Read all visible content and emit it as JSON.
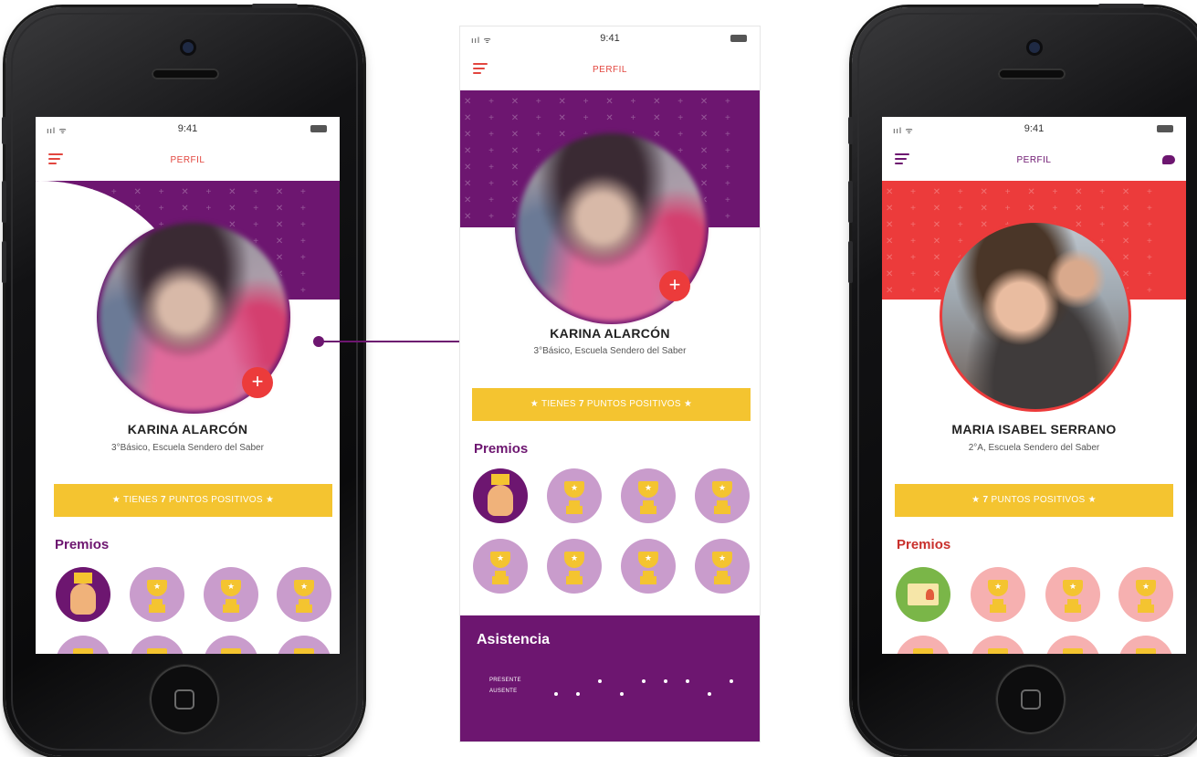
{
  "status": {
    "signal": "ııl ᯤ",
    "time": "9:41"
  },
  "left_phone": {
    "header_title": "PERFIL",
    "name": "KARINA ALARCÓN",
    "school": "3°Básico, Escuela Sendero del Saber",
    "points_prefix": "TIENES ",
    "points_value": "7",
    "points_suffix": " PUNTOS POSITIVOS",
    "awards_title": "Premios"
  },
  "center_screen": {
    "header_title": "PERFIL",
    "name": "KARINA ALARCÓN",
    "school": "3°Básico, Escuela Sendero del Saber",
    "points_prefix": "TIENES ",
    "points_value": "7",
    "points_suffix": " PUNTOS POSITIVOS",
    "awards_title": "Premios",
    "attendance_title": "Asistencia",
    "attendance_present_label": "PRESENTE",
    "attendance_absent_label": "AUSENTE",
    "attendance_pattern": [
      "absent",
      "absent",
      "present",
      "absent",
      "present",
      "present",
      "present",
      "absent",
      "present"
    ]
  },
  "right_phone": {
    "header_title": "PERFIL",
    "name": "MARIA ISABEL SERRANO",
    "school": "2°A, Escuela Sendero del Saber",
    "points_value": "7",
    "points_suffix": " PUNTOS POSITIVOS",
    "awards_title": "Premios"
  },
  "icons": {
    "plus": "+",
    "star": "★",
    "menu": "menu-icon",
    "chat": "chat-icon"
  },
  "colors": {
    "purple": "#6d1670",
    "red": "#ec3b3b",
    "yellow": "#f4c430",
    "lilac": "#c99ccc",
    "pink": "#f6b0b0",
    "green": "#7ab648"
  }
}
